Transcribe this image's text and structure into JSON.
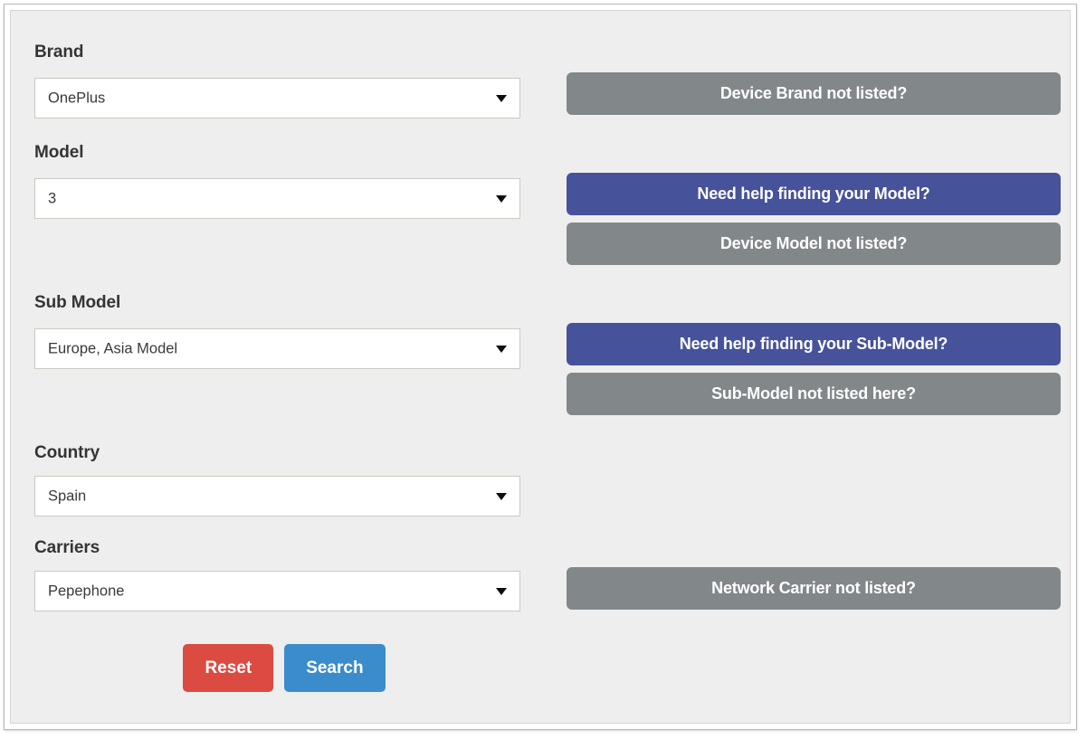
{
  "form": {
    "fields": [
      {
        "label": "Brand",
        "value": "OnePlus",
        "name": "brand"
      },
      {
        "label": "Model",
        "value": "3",
        "name": "model"
      },
      {
        "label": "Sub Model",
        "value": "Europe, Asia Model",
        "name": "sub-model"
      },
      {
        "label": "Country",
        "value": "Spain",
        "name": "country"
      },
      {
        "label": "Carriers",
        "value": "Pepephone",
        "name": "carriers"
      }
    ],
    "help_buttons": [
      {
        "label": "Device Brand not listed?",
        "style": "grey",
        "name": "device-brand-not-listed"
      },
      {
        "label": "Need help finding your Model?",
        "style": "indigo",
        "name": "need-help-finding-model"
      },
      {
        "label": "Device Model not listed?",
        "style": "grey",
        "name": "device-model-not-listed"
      },
      {
        "label": "Need help finding your Sub-Model?",
        "style": "indigo",
        "name": "need-help-finding-sub-model"
      },
      {
        "label": "Sub-Model not listed here?",
        "style": "grey",
        "name": "sub-model-not-listed-here"
      },
      {
        "label": "Network Carrier not listed?",
        "style": "grey",
        "name": "network-carrier-not-listed"
      }
    ],
    "actions": {
      "reset_label": "Reset",
      "search_label": "Search"
    },
    "icons": {
      "dropdown": "chevron-down-icon"
    }
  },
  "colors": {
    "grey_button": "#82878a",
    "indigo_button": "#46529a",
    "reset_red": "#dc4b42",
    "search_blue": "#3b8ccb",
    "panel_bg": "#efeeee",
    "label_text": "#343434"
  }
}
